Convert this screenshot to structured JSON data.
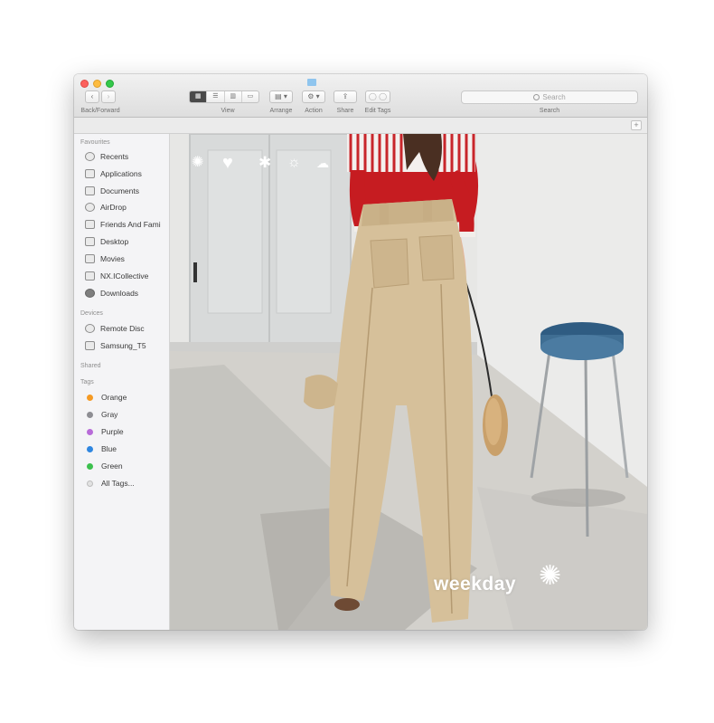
{
  "toolbar": {
    "back_label": "‹",
    "forward_label": "›",
    "back_forward_caption": "Back/Forward",
    "view_caption": "View",
    "view_modes": [
      "▦",
      "☰",
      "▥",
      "▭"
    ],
    "arrange_label": "▤ ▾",
    "arrange_caption": "Arrange",
    "action_label": "⚙ ▾",
    "action_caption": "Action",
    "share_label": "⇪",
    "share_caption": "Share",
    "edit_tags_label": "◯ ◯",
    "edit_tags_caption": "Edit Tags",
    "search_placeholder": "Search",
    "search_caption": "Search",
    "add_label": "+"
  },
  "sidebar": {
    "favourites_title": "Favourites",
    "favourites": [
      {
        "label": "Recents",
        "icon": "clock-icon"
      },
      {
        "label": "Applications",
        "icon": "applications-icon"
      },
      {
        "label": "Documents",
        "icon": "documents-icon"
      },
      {
        "label": "AirDrop",
        "icon": "airdrop-icon"
      },
      {
        "label": "Friends And Fami",
        "icon": "folder-icon"
      },
      {
        "label": "Desktop",
        "icon": "desktop-icon"
      },
      {
        "label": "Movies",
        "icon": "movies-icon"
      },
      {
        "label": "NX.ICollective",
        "icon": "folder-icon"
      },
      {
        "label": "Downloads",
        "icon": "downloads-icon"
      }
    ],
    "devices_title": "Devices",
    "devices": [
      {
        "label": "Remote Disc",
        "icon": "disc-icon"
      },
      {
        "label": "Samsung_T5",
        "icon": "drive-icon"
      }
    ],
    "shared_title": "Shared",
    "tags_title": "Tags",
    "tags": [
      {
        "label": "Orange",
        "color": "#f59a23"
      },
      {
        "label": "Gray",
        "color": "#8e8e93"
      },
      {
        "label": "Purple",
        "color": "#b86bd8"
      },
      {
        "label": "Blue",
        "color": "#2f86e0"
      },
      {
        "label": "Green",
        "color": "#3cc04e"
      },
      {
        "label": "All Tags...",
        "color": "#d8d8d8"
      }
    ]
  },
  "content": {
    "photo_subject": "wide-leg khaki trousers",
    "brand": "weekday",
    "decor_icons": [
      "sparkle-icon",
      "heart-icon",
      "star-icon",
      "sun-icon",
      "cloud-icon"
    ]
  },
  "colors": {
    "khaki": "#d6c09a",
    "red_top": "#c61c21",
    "stool_seat": "#3f6e93",
    "wall": "#e9e9e7"
  }
}
